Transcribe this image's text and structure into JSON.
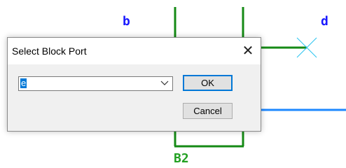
{
  "schematic": {
    "labels": {
      "b": "b",
      "d": "d",
      "block": "B2"
    },
    "colors": {
      "wire_green": "#158a15",
      "wire_blue": "#1e88ff",
      "marker_cyan": "#27c3f0",
      "label_blue": "#1a1aff",
      "label_green": "#22a022"
    }
  },
  "dialog": {
    "title": "Select Block Port",
    "close_glyph": "✕",
    "port_select": {
      "value": "e"
    },
    "ok_label": "OK",
    "cancel_label": "Cancel"
  },
  "icons": {
    "close": "close-icon",
    "dropdown": "chevron-down-icon",
    "no_connect": "no-connect-marker-icon"
  }
}
